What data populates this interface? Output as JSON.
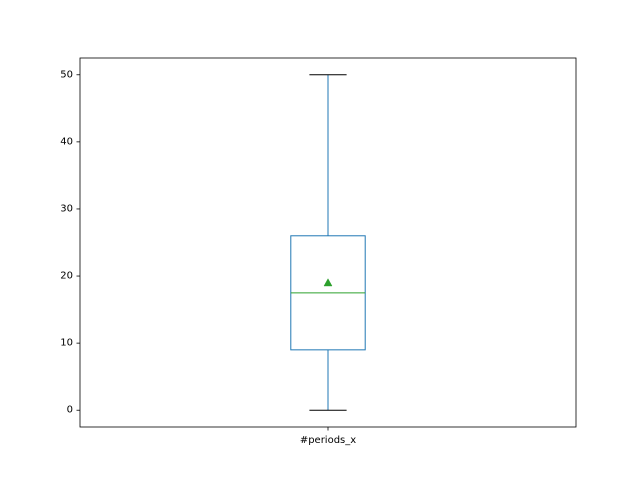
{
  "chart_data": {
    "type": "box",
    "title": "",
    "xlabel": "",
    "ylabel": "",
    "categories": [
      "#periods_x"
    ],
    "ylim": [
      -2.5,
      52.5
    ],
    "y_ticks": [
      0,
      10,
      20,
      30,
      40,
      50
    ],
    "grid": false,
    "boxes": [
      {
        "category": "#periods_x",
        "whisker_low": 0,
        "q1": 9,
        "median": 17.5,
        "q3": 26,
        "whisker_high": 50,
        "mean": 19
      }
    ],
    "colors": {
      "box": "#1f77b4",
      "median": "#2ca02c",
      "mean": "#2ca02c",
      "axes": "#000000"
    }
  }
}
